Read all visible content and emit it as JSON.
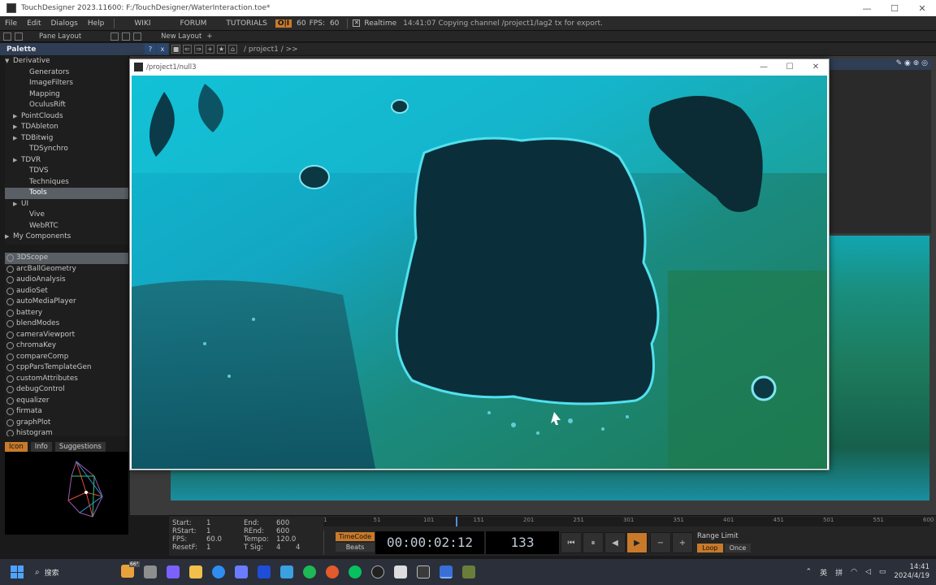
{
  "window": {
    "title": "TouchDesigner 2023.11600: F:/TouchDesigner/WaterInteraction.toe*"
  },
  "menubar": {
    "items": [
      "File",
      "Edit",
      "Dialogs",
      "Help"
    ],
    "links": [
      "WIKI",
      "FORUM",
      "TUTORIALS"
    ],
    "perf_label": "O|I",
    "fps_target": "60",
    "fps_label": "FPS:",
    "fps_value": "60",
    "realtime_label": "Realtime",
    "status": "14:41:07 Copying channel /project1/lag2 tx for export."
  },
  "toolbar": {
    "pane_layout": "Pane Layout",
    "new_layout": "New Layout",
    "new_layout_plus": "+"
  },
  "palette": {
    "title": "Palette",
    "header_buttons": [
      "?",
      "x"
    ],
    "tree": [
      {
        "label": "Derivative",
        "indent": 0,
        "arrow": "▼",
        "selected": false
      },
      {
        "label": "Generators",
        "indent": 2,
        "arrow": "",
        "selected": false
      },
      {
        "label": "ImageFilters",
        "indent": 2,
        "arrow": "",
        "selected": false
      },
      {
        "label": "Mapping",
        "indent": 2,
        "arrow": "",
        "selected": false
      },
      {
        "label": "OculusRift",
        "indent": 2,
        "arrow": "",
        "selected": false
      },
      {
        "label": "PointClouds",
        "indent": 1,
        "arrow": "▶",
        "selected": false
      },
      {
        "label": "TDAbleton",
        "indent": 1,
        "arrow": "▶",
        "selected": false
      },
      {
        "label": "TDBitwig",
        "indent": 1,
        "arrow": "▶",
        "selected": false
      },
      {
        "label": "TDSynchro",
        "indent": 2,
        "arrow": "",
        "selected": false
      },
      {
        "label": "TDVR",
        "indent": 1,
        "arrow": "▶",
        "selected": false
      },
      {
        "label": "TDVS",
        "indent": 2,
        "arrow": "",
        "selected": false
      },
      {
        "label": "Techniques",
        "indent": 2,
        "arrow": "",
        "selected": false
      },
      {
        "label": "Tools",
        "indent": 2,
        "arrow": "",
        "selected": true
      },
      {
        "label": "UI",
        "indent": 1,
        "arrow": "▶",
        "selected": false
      },
      {
        "label": "Vive",
        "indent": 2,
        "arrow": "",
        "selected": false
      },
      {
        "label": "WebRTC",
        "indent": 2,
        "arrow": "",
        "selected": false
      },
      {
        "label": "My Components",
        "indent": 0,
        "arrow": "▶",
        "selected": false
      }
    ],
    "components": [
      {
        "label": "3DScope",
        "selected": true
      },
      {
        "label": "arcBallGeometry",
        "selected": false
      },
      {
        "label": "audioAnalysis",
        "selected": false
      },
      {
        "label": "audioSet",
        "selected": false
      },
      {
        "label": "autoMediaPlayer",
        "selected": false
      },
      {
        "label": "battery",
        "selected": false
      },
      {
        "label": "blendModes",
        "selected": false
      },
      {
        "label": "cameraViewport",
        "selected": false
      },
      {
        "label": "chromaKey",
        "selected": false
      },
      {
        "label": "compareComp",
        "selected": false
      },
      {
        "label": "cppParsTemplateGen",
        "selected": false
      },
      {
        "label": "customAttributes",
        "selected": false
      },
      {
        "label": "debugControl",
        "selected": false
      },
      {
        "label": "equalizer",
        "selected": false
      },
      {
        "label": "firmata",
        "selected": false
      },
      {
        "label": "graphPlot",
        "selected": false
      },
      {
        "label": "histogram",
        "selected": false
      }
    ],
    "tabs": [
      {
        "label": "Icon",
        "active": true
      },
      {
        "label": "Info",
        "active": false
      },
      {
        "label": "Suggestions",
        "active": false
      }
    ]
  },
  "network": {
    "path": "/ project1 / >>"
  },
  "viewer": {
    "title": "/project1/null3",
    "buttons": [
      "—",
      "☐",
      "✕"
    ]
  },
  "timeline": {
    "start_label": "Start:",
    "start_value": "1",
    "rstart_label": "RStart:",
    "rstart_value": "1",
    "fps_label": "FPS:",
    "fps_value": "60.0",
    "resetf_label": "ResetF:",
    "resetf_value": "1",
    "end_label": "End:",
    "end_value": "600",
    "rend_label": "REnd:",
    "rend_value": "600",
    "tempo_label": "Tempo:",
    "tempo_value": "120.0",
    "tsig_label": "T Sig:",
    "tsig_value_a": "4",
    "tsig_value_b": "4",
    "ruler_ticks": [
      "1",
      "51",
      "101",
      "151",
      "201",
      "251",
      "301",
      "351",
      "401",
      "451",
      "501",
      "551",
      "600"
    ],
    "timecode_button": "TimeCode",
    "beats_button": "Beats",
    "timecode": "00:00:02:12",
    "frame": "133",
    "transport": [
      "⏮",
      "⏸",
      "◀",
      "▶",
      "−",
      "+"
    ],
    "range_limit_label": "Range Limit",
    "loop_label": "Loop",
    "once_label": "Once"
  },
  "taskbar": {
    "search_placeholder": "搜索",
    "tray_lang1": "英",
    "tray_lang2": "拼",
    "time": "14:41",
    "date": "2024/4/19",
    "weather_badge": "66°"
  }
}
